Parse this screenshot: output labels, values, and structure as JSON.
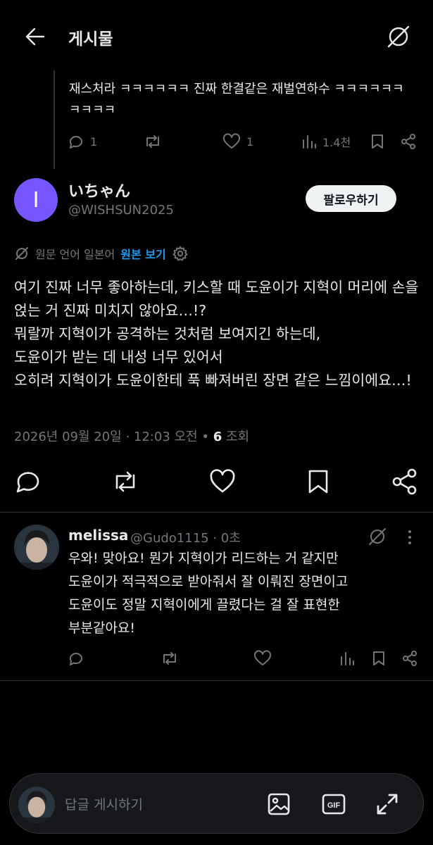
{
  "header": {
    "title": "게시물",
    "back_icon": "arrow-left-icon",
    "translate_icon": "translate-off-icon"
  },
  "previous_tweet": {
    "text": "재스처라 ㅋㅋㅋㅋㅋㅋ 진짜 한결같은 재벌연하수 ㅋㅋㅋㅋㅋㅋㅋㅋㅋㅋ",
    "replies": "1",
    "likes": "1",
    "views": "1.4천"
  },
  "tweet": {
    "author_name": "いちゃん",
    "author_handle": "@WISHSUN2025",
    "avatar_letter": "I",
    "avatar_color": "#7856ff",
    "follow_label": "팔로우하기",
    "translation_note": "원문 언어 일본어",
    "show_original_label": "원본 보기",
    "body": "여기 진짜 너무 좋아하는데, 키스할 때 도윤이가 지혁이 머리에 손을 얹는 거 진짜 미치지 않아요…!?\n뭐랄까 지혁이가 공격하는 것처럼 보여지긴 하는데,\n도윤이가 받는 데 내성 너무 있어서\n오히려 지혁이가 도윤이한테 푹 빠져버린 장면 같은 느낌이에요…!",
    "timestamp": "2026년 09월 20일 · 12:03 오전",
    "separator": "•",
    "views_count": "6",
    "views_label": "조회"
  },
  "reply": {
    "author_name": "melissa",
    "author_handle": "@Gudo1115 · 0초",
    "body": "우와! 맞아요! 뭔가 지혁이가 리드하는 거 같지만\n도윤이가 적극적으로 받아줘서 잘 이뤄진 장면이고\n도윤이도 정말 지혁이에게 끌렸다는 걸 잘 표현한\n부분같아요!"
  },
  "compose": {
    "placeholder": "답글 게시하기",
    "gif_label": "GIF"
  },
  "colors": {
    "background": "#000000",
    "text": "#e7e9ea",
    "muted": "#71767b",
    "link": "#1d9bf0"
  }
}
